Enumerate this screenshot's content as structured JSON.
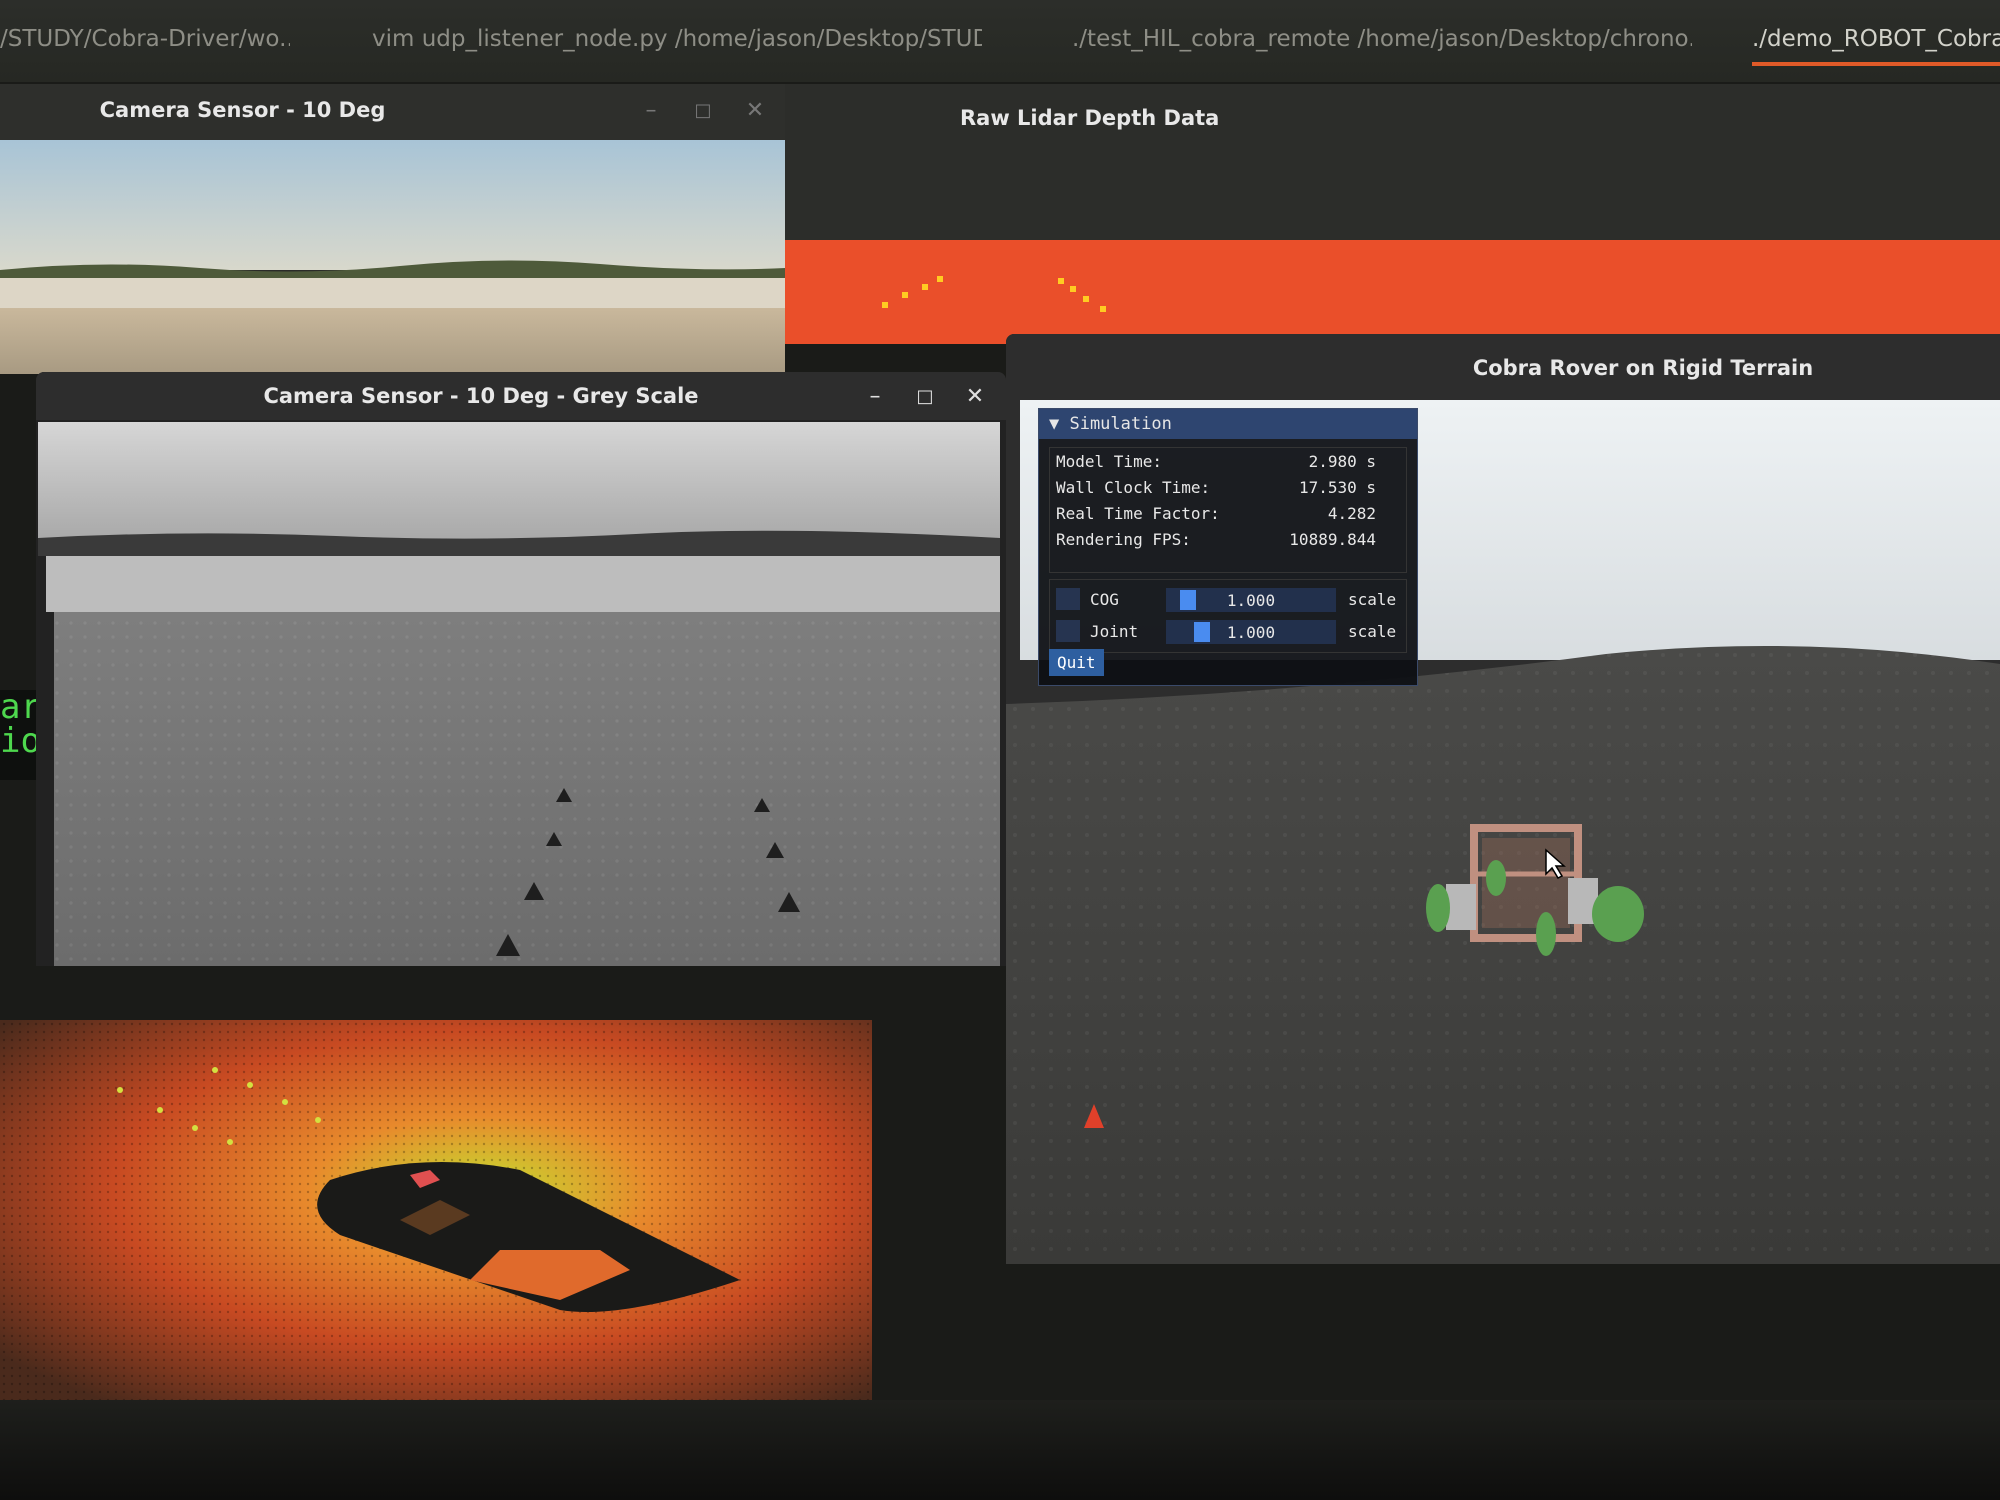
{
  "tabs": [
    {
      "label": "/STUDY/Cobra-Driver/wo..."
    },
    {
      "label": "vim udp_listener_node.py /home/jason/Desktop/STUDY..."
    },
    {
      "label": "./test_HIL_cobra_remote /home/jason/Desktop/chrono..."
    },
    {
      "label": "./demo_ROBOT_Cobra"
    }
  ],
  "windows": {
    "camera": {
      "title": "Camera Sensor - 10 Deg"
    },
    "lidar": {
      "title": "Raw Lidar Depth Data"
    },
    "grey": {
      "title": "Camera Sensor - 10 Deg - Grey Scale"
    },
    "rover": {
      "title": "Cobra Rover on Rigid Terrain"
    }
  },
  "terminal_fragments": {
    "line1": "ar",
    "line2": "ion"
  },
  "simulation": {
    "header": "▼ Simulation",
    "stats": [
      {
        "label": "Model Time:",
        "value": "2.980 s"
      },
      {
        "label": "Wall Clock Time:",
        "value": "17.530 s"
      },
      {
        "label": "Real Time Factor:",
        "value": "4.282"
      },
      {
        "label": "Rendering FPS:",
        "value": "10889.844"
      }
    ],
    "sliders": [
      {
        "label": "COG",
        "value": "1.000",
        "unit": "scale"
      },
      {
        "label": "Joint",
        "value": "1.000",
        "unit": "scale"
      }
    ],
    "quit_label": "Quit"
  },
  "colors": {
    "accent": "#e05a28",
    "imgui_header": "#2e4570",
    "slider_grab": "#4a8cf0"
  },
  "icons": {
    "minimize": "minimize-icon",
    "maximize": "maximize-icon",
    "close": "close-icon",
    "cursor": "mouse-pointer-icon"
  }
}
